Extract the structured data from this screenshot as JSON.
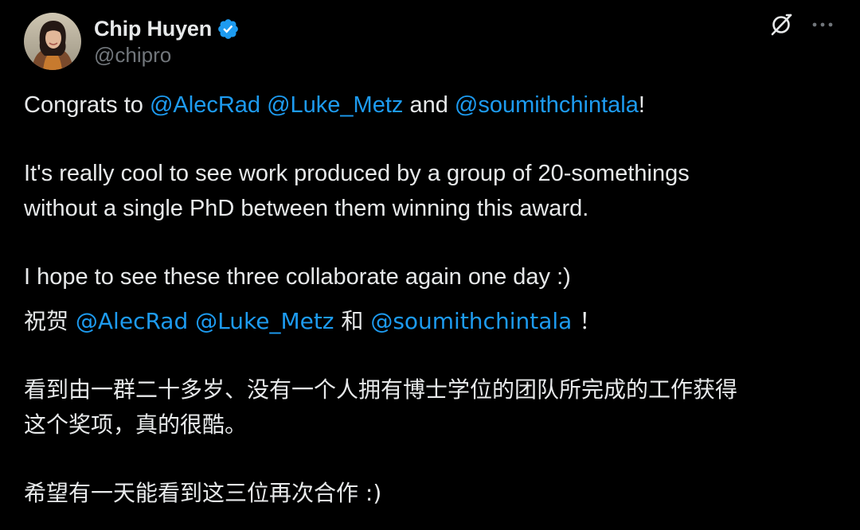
{
  "author": {
    "display_name": "Chip Huyen",
    "handle": "@chipro",
    "verified": true
  },
  "icons": {
    "avatar": "profile-photo",
    "verified": "verified-badge-icon",
    "grok": "grok-icon",
    "more": "more-options-icon"
  },
  "colors": {
    "background": "#000000",
    "text": "#e7e9ea",
    "secondary_text": "#71767b",
    "link": "#1d9bf0",
    "verified": "#1d9bf0"
  },
  "tweet": {
    "en": {
      "p1": {
        "prefix": "Congrats to ",
        "mention1": "@AlecRad",
        "sep1": " ",
        "mention2": "@Luke_Metz",
        "sep2": " and ",
        "mention3": "@soumithchintala",
        "suffix": "!"
      },
      "p2_line1": "It's really cool to see work produced by a group of 20-somethings",
      "p2_line2": "without a single PhD between them winning this award.",
      "p3": "I hope to see these three collaborate again one day :)"
    },
    "zh": {
      "p1": {
        "prefix": "祝贺 ",
        "mention1": "@AlecRad",
        "sep1": " ",
        "mention2": "@Luke_Metz",
        "sep2": " 和 ",
        "mention3": "@soumithchintala",
        "suffix": " ！"
      },
      "p2_line1": "看到由一群二十多岁、没有一个人拥有博士学位的团队所完成的工作获得",
      "p2_line2": "这个奖项，真的很酷。",
      "p3": "希望有一天能看到这三位再次合作 :)"
    }
  }
}
